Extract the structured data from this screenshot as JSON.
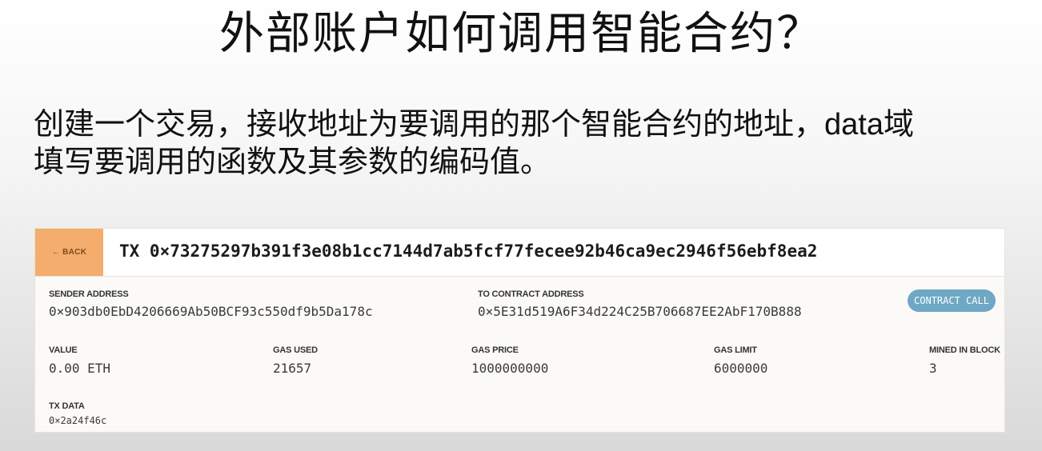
{
  "slide": {
    "title": "外部账户如何调用智能合约？",
    "body_line1_a": "创建一个交易，接收地址为要调用的那个智能合约的地址，",
    "body_line1_b": "data",
    "body_line1_c": "域",
    "body_line2": "填写要调用的函数及其参数的编码值。"
  },
  "tx": {
    "back_label": "← BACK",
    "title": "TX 0×73275297b391f3e08b1cc7144d7ab5fcf77fecee92b46ca9ec2946f56ebf8ea2",
    "sender_label": "SENDER ADDRESS",
    "sender_value": "0×903db0EbD4206669Ab50BCF93c550df9b5Da178c",
    "to_label": "TO CONTRACT ADDRESS",
    "to_value": "0×5E31d519A6F34d224C25B706687EE2AbF170B888",
    "badge": "CONTRACT CALL",
    "value_label": "VALUE",
    "value_value": "0.00 ETH",
    "gas_used_label": "GAS USED",
    "gas_used_value": "21657",
    "gas_price_label": "GAS PRICE",
    "gas_price_value": "1000000000",
    "gas_limit_label": "GAS LIMIT",
    "gas_limit_value": "6000000",
    "mined_label": "MINED IN BLOCK",
    "mined_value": "3",
    "data_label": "TX DATA",
    "data_value": "0×2a24f46c"
  },
  "colors": {
    "back_button": "#f4ad6c",
    "badge": "#6ea8c4",
    "panel_bg": "#fbfaf7"
  }
}
